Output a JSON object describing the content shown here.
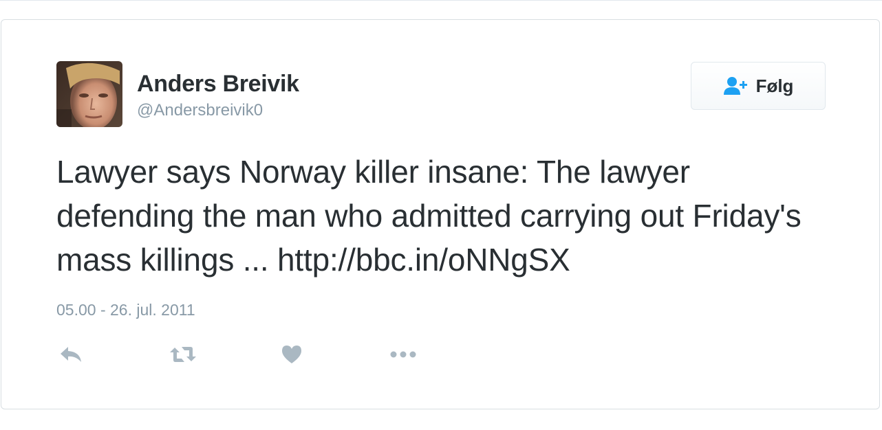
{
  "tweet": {
    "user": {
      "name": "Anders Breivik",
      "handle": "@Andersbreivik0",
      "avatar_icon": "profile-photo"
    },
    "follow_button": {
      "label": "Følg",
      "icon": "add-user-icon"
    },
    "text": "Lawyer says Norway killer insane: The lawyer defending the man who admitted carrying out Friday's mass killings ... http://bbc.in/oNNgSX",
    "timestamp": "05.00 - 26. jul. 2011",
    "actions": [
      {
        "name": "reply",
        "icon": "reply-icon"
      },
      {
        "name": "retweet",
        "icon": "retweet-icon"
      },
      {
        "name": "like",
        "icon": "heart-icon"
      },
      {
        "name": "more",
        "icon": "more-icon"
      }
    ]
  },
  "colors": {
    "text_primary": "#292f33",
    "text_secondary": "#8899a6",
    "action_icon": "#aab8c2",
    "accent": "#1da1f2"
  }
}
